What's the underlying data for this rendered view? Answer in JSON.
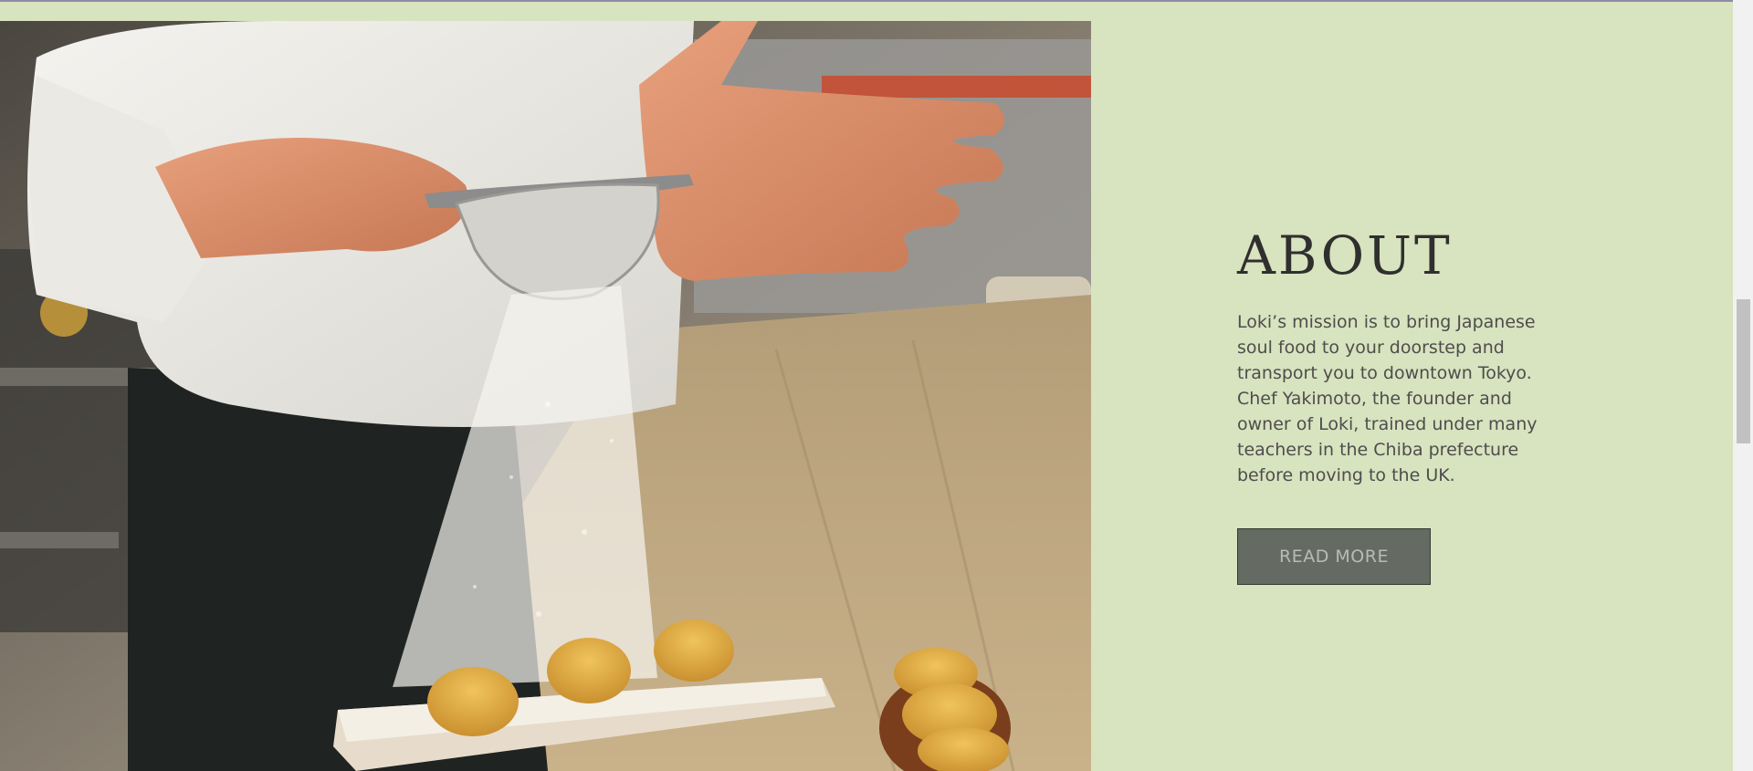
{
  "about": {
    "title": "ABOUT",
    "text": "Loki’s mission is to bring Japanese soul food to your doorstep and transport you to downtown Tokyo. Chef Yakimoto, the founder and owner of Loki, trained under many teachers in the Chiba prefecture before moving to the UK.",
    "button_label": "READ MORE"
  },
  "colors": {
    "page_background": "#d8e3bf",
    "button_background": "#656b62",
    "button_text": "#b8bdb1",
    "title_text": "#2f2f2f"
  },
  "photo": {
    "subject": "chef dusting pastries with powdered sugar through a sieve"
  }
}
